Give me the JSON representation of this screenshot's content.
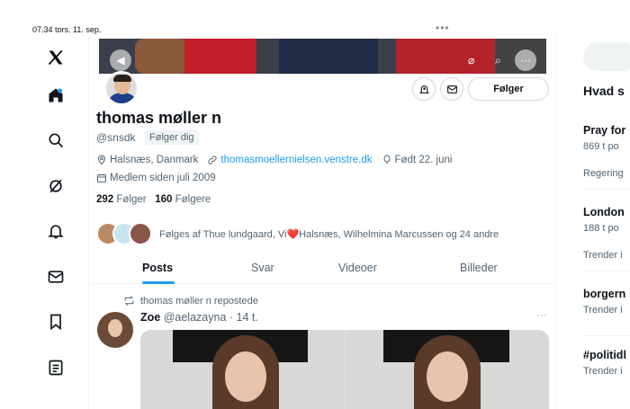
{
  "status": {
    "time": "07.34  tors. 11. sep.",
    "dots": "•••"
  },
  "nav": [
    "x-logo-icon",
    "home-icon",
    "search-icon",
    "grok-icon",
    "notifications-icon",
    "messages-icon",
    "bookmarks-icon",
    "lists-icon"
  ],
  "profile": {
    "name": "thomas møller n",
    "handle": "@snsdk",
    "follows_you": "Følger dig",
    "follow_button": "Følger",
    "location": "Halsnæs, Danmark",
    "website": "thomasmoellernielsen.venstre.dk",
    "birthday": "Født 22. juni",
    "joined": "Medlem siden juli 2009",
    "following_count": "292",
    "following_label": "Følger",
    "followers_count": "160",
    "followers_label": "Følgere",
    "followed_by": "Følges af Thue lundgaard, Vi❤️Halsnæs, Wilhelmina Marcussen og 24 andre"
  },
  "tabs": [
    "Posts",
    "Svar",
    "Videoer",
    "Billeder"
  ],
  "post": {
    "repost_label": "thomas møller n repostede",
    "author": "Zoe",
    "meta": "@aelazayna · 14 t.",
    "more": "···"
  },
  "right": {
    "title": "Hvad s",
    "trends": [
      {
        "name": "Pray for",
        "sub": "869 t po"
      },
      {
        "name": "",
        "sub": "Regering"
      },
      {
        "name": "London",
        "sub": "188 t po"
      },
      {
        "name": "",
        "sub": "Trender i"
      },
      {
        "name": "borgern",
        "sub": "Trender i"
      },
      {
        "name": "#politidl",
        "sub": "Trender i"
      }
    ]
  },
  "colors": {
    "accent": "#1d9bf0",
    "text": "#0f1419",
    "muted": "#536471"
  }
}
